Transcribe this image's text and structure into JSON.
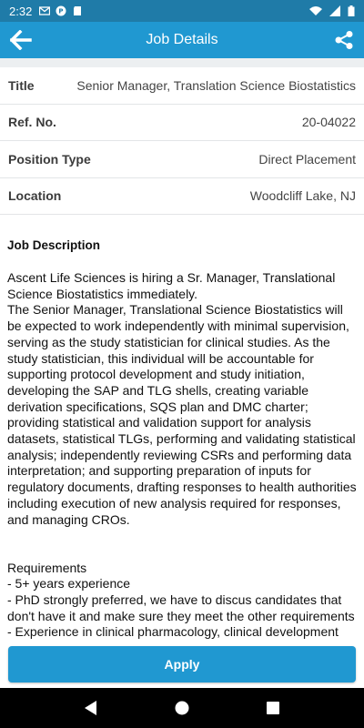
{
  "status_bar": {
    "time": "2:32",
    "icons_left": [
      "gmail-icon",
      "fp-icon",
      "sd-card-icon"
    ],
    "icons_right": [
      "wifi-icon",
      "signal-icon",
      "battery-icon"
    ]
  },
  "app_bar": {
    "title": "Job Details",
    "back_icon": "arrow-left-icon",
    "share_icon": "share-icon",
    "background": "#2098d1"
  },
  "details": [
    {
      "label": "Title",
      "value": "Senior Manager, Translation Science Biostatistics"
    },
    {
      "label": "Ref. No.",
      "value": "20-04022"
    },
    {
      "label": "Position Type",
      "value": "Direct Placement"
    },
    {
      "label": "Location",
      "value": "Woodcliff Lake, NJ"
    }
  ],
  "description": {
    "heading": "Job Description",
    "text": "Ascent Life Sciences is hiring a Sr. Manager, Translational Science Biostatistics immediately.\nThe Senior Manager, Translational Science Biostatistics will be expected to work independently with minimal supervision, serving as the study statistician for clinical studies. As the study statistician, this individual will be accountable for supporting protocol development and study initiation, developing the SAP and TLG shells, creating variable derivation specifications, SQS plan and DMC charter; providing statistical and validation support for analysis datasets, statistical TLGs, performing and validating statistical analysis; independently reviewing CSRs and performing data interpretation; and supporting preparation of inputs for regulatory documents, drafting responses to health authorities including execution of new analysis required for responses, and managing CROs.\n\n\nRequirements\n- 5+ years experience\n- PhD strongly preferred, we have to discus candidates that don't have it and make sure they meet the other requirements\n- Experience in clinical pharmacology, clinical development"
  },
  "apply": {
    "label": "Apply"
  },
  "nav_bar": {
    "back": "nav-back-icon",
    "home": "nav-home-icon",
    "recents": "nav-recents-icon"
  }
}
